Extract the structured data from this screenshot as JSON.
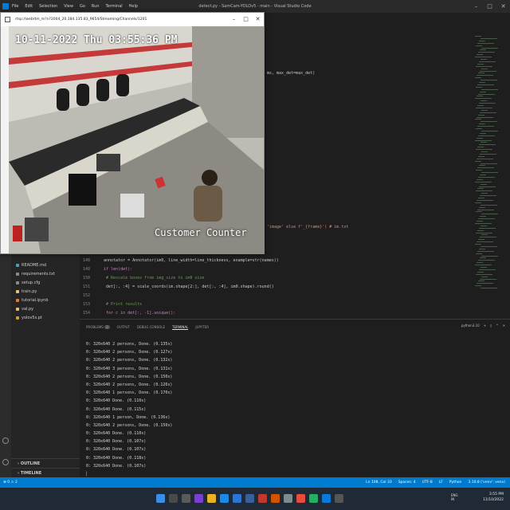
{
  "titlebar": {
    "menus": [
      "File",
      "Edit",
      "Selection",
      "View",
      "Go",
      "Run",
      "Terminal",
      "Help"
    ],
    "window_title": "detect.py - SamCam-YOLOv5 - main - Visual Studio Code"
  },
  "camera_window": {
    "title": "rtsp://webrtm_m?n?2004_20.184.135.83_9654/Streaming/Channels/1201",
    "timestamp": "10-11-2022 Thu 03:55:36 PM",
    "overlay_label": "Customer Counter"
  },
  "editor": {
    "visible_line_fragment": "ms, max_det=max_det)",
    "visible_line_fragment2": "'image' else f'_{frame}') # im.txt",
    "lines": [
      {
        "num": "148",
        "text": "annotator = Annotator(im0, line_width=line_thickness, example=str(names))"
      },
      {
        "num": "149",
        "text": "if len(det):"
      },
      {
        "num": "150",
        "text": "    # Rescale boxes from img_size to im0 size"
      },
      {
        "num": "151",
        "text": "    det[:, :4] = scale_coords(im.shape[2:], det[:, :4], im0.shape).round()"
      },
      {
        "num": "152",
        "text": ""
      },
      {
        "num": "153",
        "text": "    # Print results"
      },
      {
        "num": "154",
        "text": "    for c in det[:, -1].unique():"
      }
    ]
  },
  "sidebar": {
    "files": [
      {
        "name": "README.md",
        "color": "#519aba"
      },
      {
        "name": "requirements.txt",
        "color": "#8a8a8a"
      },
      {
        "name": "setup.cfg",
        "color": "#8a8a8a"
      },
      {
        "name": "train.py",
        "color": "#e5c07b"
      },
      {
        "name": "tutorial.ipynb",
        "color": "#e37933"
      },
      {
        "name": "val.py",
        "color": "#e5c07b"
      },
      {
        "name": "yolov5s.pt",
        "color": "#c9a227"
      }
    ],
    "outline": "OUTLINE",
    "timeline": "TIMELINE"
  },
  "panel": {
    "tabs": [
      "PROBLEMS",
      "OUTPUT",
      "DEBUG CONSOLE",
      "TERMINAL",
      "JUPYTER"
    ],
    "problems_count": "2",
    "active_tab": "TERMINAL",
    "shell": "python3.10",
    "terminal_lines": [
      "0: 320x640 2 persons, Done. (0.135s)",
      "0: 320x640 2 persons, Done. (0.127s)",
      "0: 320x640 2 persons, Done. (0.132s)",
      "0: 320x640 3 persons, Done. (0.131s)",
      "0: 320x640 2 persons, Done. (0.150s)",
      "0: 320x640 2 persons, Done. (0.126s)",
      "0: 320x640 1 persons, Done. (0.170s)",
      "0: 320x640 Done. (0.110s)",
      "0: 320x640 Done. (0.115s)",
      "0: 320x640 1 person, Done. (0.136s)",
      "0: 320x640 2 persons, Done. (0.150s)",
      "0: 320x640 Done. (0.110s)",
      "0: 320x640 Done. (0.107s)",
      "0: 320x640 Done. (0.107s)",
      "0: 320x640 Done. (0.118s)",
      "0: 320x640 Done. (0.107s)"
    ]
  },
  "statusbar": {
    "left": "⊗ 0 ⚠ 2",
    "items": [
      "Ln 108, Col 33",
      "Spaces: 4",
      "UTF-8",
      "LF",
      "Python",
      "3.10.8 ('venv': venv)"
    ]
  },
  "taskbar": {
    "lang_line1": "ENG",
    "lang_line2": "IN",
    "time": "3:55 PM",
    "date": "11/10/2022"
  },
  "colors": {
    "accent": "#007acc",
    "editor_bg": "#1e1e1e",
    "sidebar_bg": "#252526"
  }
}
